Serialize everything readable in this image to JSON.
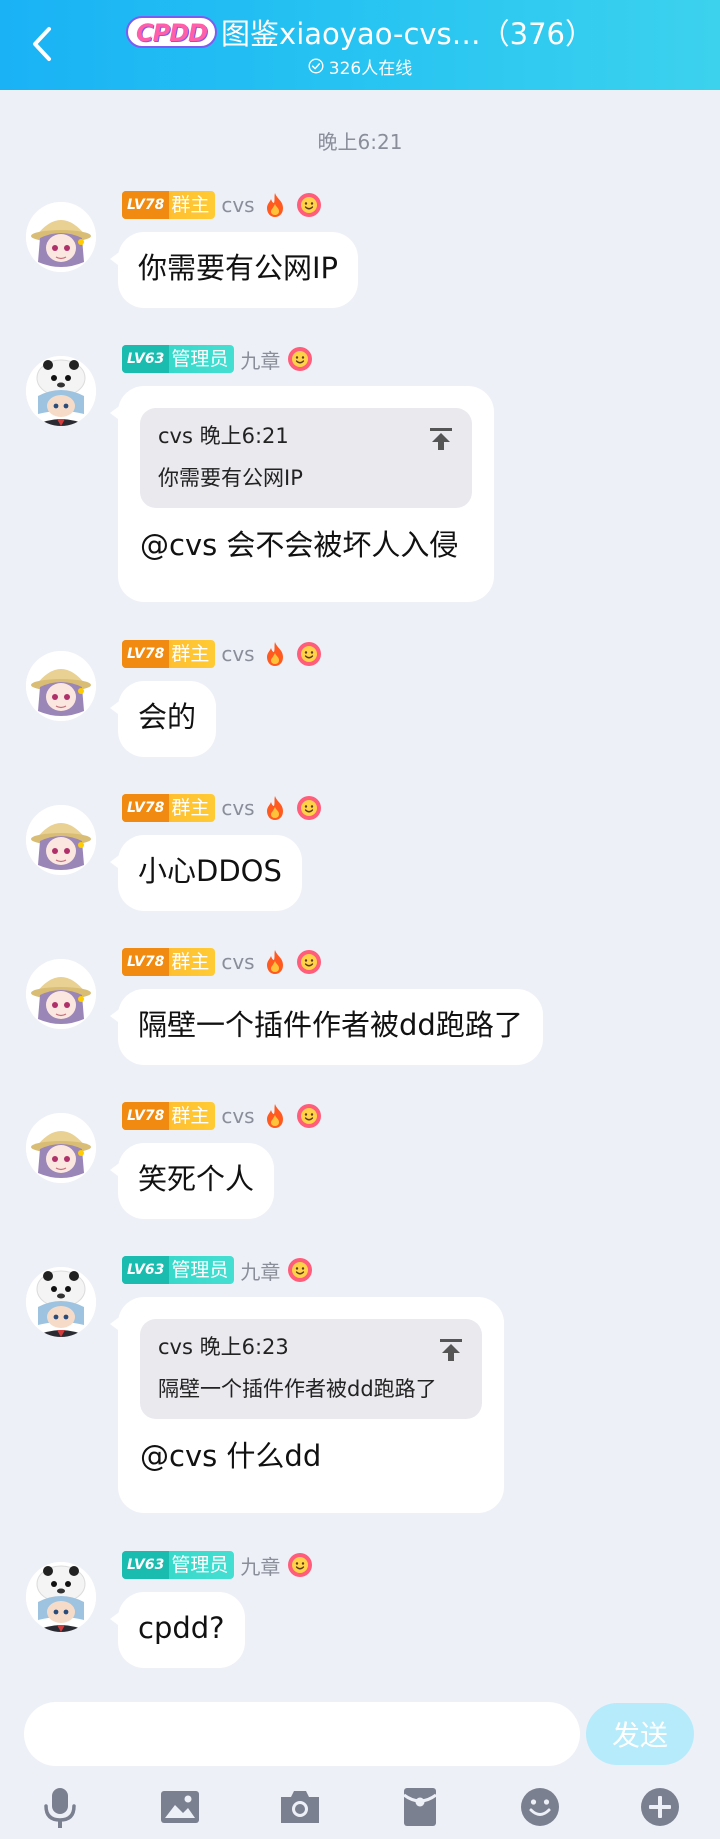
{
  "header": {
    "logo_text": "CPDD",
    "title": "图鉴xiaoyao-cvs…（376）",
    "online": "326人在线"
  },
  "chat": {
    "time_separator": "晚上6:21",
    "messages": [
      {
        "level": "LV78",
        "role": "群主",
        "nick": "cvs",
        "text": "你需要有公网IP"
      },
      {
        "level": "LV63",
        "role": "管理员",
        "nick": "九章",
        "quote_head": "cvs 晚上6:21",
        "quote_body": "你需要有公网IP",
        "text": "@cvs 会不会被坏人入侵"
      },
      {
        "level": "LV78",
        "role": "群主",
        "nick": "cvs",
        "text": "会的"
      },
      {
        "level": "LV78",
        "role": "群主",
        "nick": "cvs",
        "text": "小心DDOS"
      },
      {
        "level": "LV78",
        "role": "群主",
        "nick": "cvs",
        "text": "隔壁一个插件作者被dd跑路了"
      },
      {
        "level": "LV78",
        "role": "群主",
        "nick": "cvs",
        "text": "笑死个人"
      },
      {
        "level": "LV63",
        "role": "管理员",
        "nick": "九章",
        "quote_head": "cvs 晚上6:23",
        "quote_body": "隔壁一个插件作者被dd跑路了",
        "text": "@cvs 什么dd"
      },
      {
        "level": "LV63",
        "role": "管理员",
        "nick": "九章",
        "text": "cpdd?"
      }
    ]
  },
  "composer": {
    "input_value": "",
    "send_label": "发送"
  },
  "toolbar": {
    "icons": [
      "microphone-icon",
      "image-icon",
      "camera-icon",
      "red-packet-icon",
      "emoji-icon",
      "plus-icon"
    ]
  },
  "colors": {
    "header_start": "#1ab2f5",
    "header_end": "#3cd2ee",
    "background": "#eef0f8",
    "owner_badge": "#ffb22e",
    "admin_badge": "#2ed3c4",
    "send_button": "#b6ebfb",
    "toolbar_icon": "#7a8090"
  }
}
